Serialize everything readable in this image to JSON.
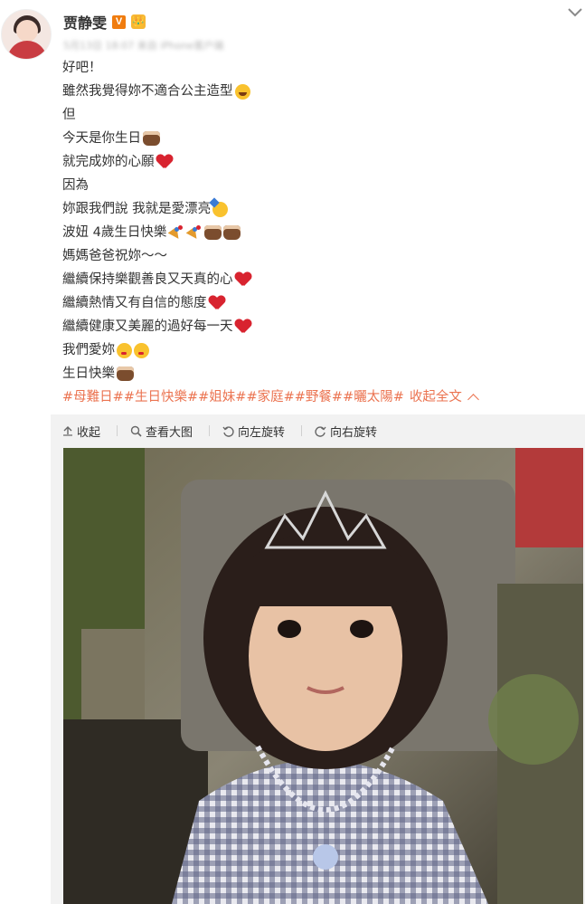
{
  "post": {
    "username": "贾静雯",
    "verified_badge": "V",
    "member_badge": "👑",
    "meta_text": "5月13日 18:07 来自 iPhone客户端"
  },
  "content": {
    "lines": [
      "好吧！",
      "雖然我覺得妳不適合公主造型",
      "但",
      "今天是你生日",
      "就完成妳的心願",
      "因為",
      "妳跟我們說 我就是愛漂亮",
      "波妞 4歲生日快樂",
      "媽媽爸爸祝妳～～",
      "繼續保持樂觀善良又天真的心",
      "繼續熱情又有自信的態度",
      "繼續健康又美麗的過好每一天",
      "我們愛妳",
      "生日快樂"
    ],
    "topics": [
      "#母難日#",
      "#生日快樂#",
      "#姐妹#",
      "#家庭#",
      "#野餐#",
      "#曬太陽#"
    ],
    "collapse_label": "收起全文"
  },
  "media_toolbar": {
    "collapse": "收起",
    "view_large": "查看大图",
    "rotate_left": "向左旋转",
    "rotate_right": "向右旋转"
  },
  "icons": {
    "chevron": "chevron-down-icon",
    "collapse": "arrow-up-icon",
    "view_large": "magnifier-icon",
    "rotate_left": "rotate-left-icon",
    "rotate_right": "rotate-right-icon"
  },
  "colors": {
    "topic": "#eb7350",
    "badge": "#f07c0f",
    "toolbar_bg": "#f2f2f2"
  }
}
